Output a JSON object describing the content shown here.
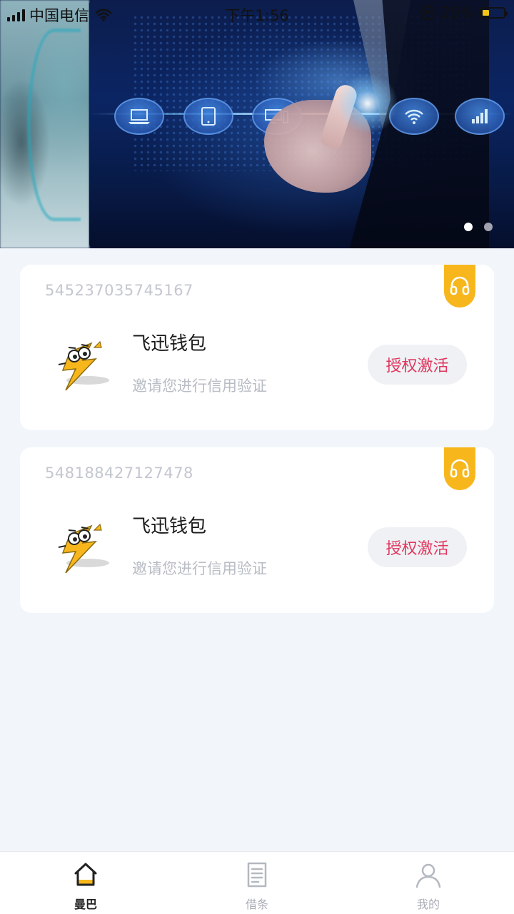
{
  "status_bar": {
    "carrier": "中国电信",
    "time": "下午1:56",
    "battery": "29%",
    "battery_level": 0.29
  },
  "banner": {
    "slide_count": 2,
    "active_slide": 1
  },
  "cards": [
    {
      "id": "545237035745167",
      "title": "飞迅钱包",
      "subtitle": "邀请您进行信用验证",
      "button": "授权激活",
      "tag_icon": "headset-icon"
    },
    {
      "id": "548188427127478",
      "title": "飞迅钱包",
      "subtitle": "邀请您进行信用验证",
      "button": "授权激活",
      "tag_icon": "headset-icon"
    }
  ],
  "tabs": [
    {
      "label": "曼巴",
      "icon": "home-icon",
      "active": true
    },
    {
      "label": "借条",
      "icon": "document-icon",
      "active": false
    },
    {
      "label": "我的",
      "icon": "person-icon",
      "active": false
    }
  ],
  "colors": {
    "accent": "#f7b71c",
    "button_text": "#e0365d",
    "page_bg": "#f2f6fb"
  }
}
